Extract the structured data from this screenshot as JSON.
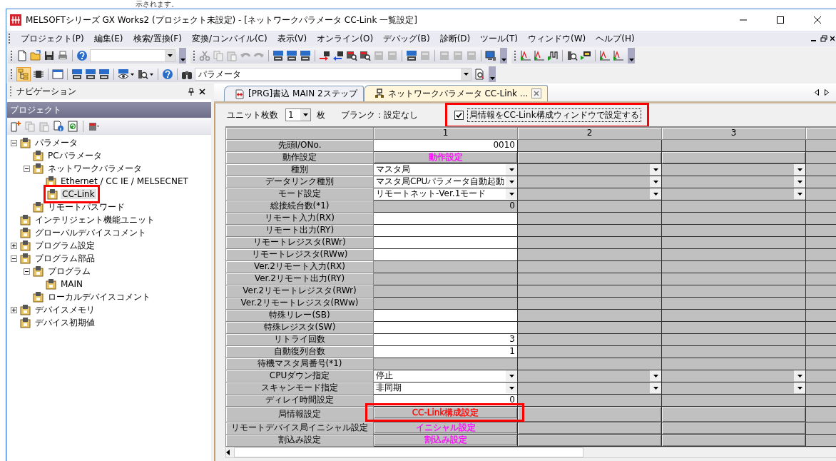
{
  "caption": "示されます。",
  "window": {
    "title": "MELSOFTシリーズ GX Works2 (プロジェクト未設定) - [ネットワークパラメータ  CC-Link 一覧設定]"
  },
  "menu": [
    "プロジェクト(P)",
    "編集(E)",
    "検索/置換(F)",
    "変換/コンパイル(C)",
    "表示(V)",
    "オンライン(O)",
    "デバッグ(B)",
    "診断(D)",
    "ツール(T)",
    "ウィンドウ(W)",
    "ヘルプ(H)"
  ],
  "toolbar": {
    "parameter_combo": {
      "value": "パラメータ"
    }
  },
  "navigation": {
    "title": "ナビゲーション",
    "section": "プロジェクト",
    "tree": [
      {
        "label": "パラメータ",
        "expanded": true,
        "selected": false,
        "highlighted": false,
        "children": [
          {
            "label": "PCパラメータ",
            "selected": false,
            "highlighted": false
          },
          {
            "label": "ネットワークパラメータ",
            "expanded": true,
            "selected": false,
            "highlighted": false,
            "children": [
              {
                "label": "Ethernet / CC IE / MELSECNET",
                "selected": false,
                "highlighted": false
              },
              {
                "label": "CC-Link",
                "selected": true,
                "highlighted": true
              }
            ]
          },
          {
            "label": "リモートパスワード",
            "selected": false,
            "highlighted": false
          }
        ]
      },
      {
        "label": "インテリジェント機能ユニット",
        "selected": false,
        "highlighted": false
      },
      {
        "label": "グローバルデバイスコメント",
        "selected": false,
        "highlighted": false
      },
      {
        "label": "プログラム設定",
        "expanded": false,
        "selected": false,
        "highlighted": false
      },
      {
        "label": "プログラム部品",
        "expanded": true,
        "selected": false,
        "highlighted": false,
        "children": [
          {
            "label": "プログラム",
            "expanded": true,
            "selected": false,
            "highlighted": false,
            "children": [
              {
                "label": "MAIN",
                "selected": false,
                "highlighted": false
              }
            ]
          },
          {
            "label": "ローカルデバイスコメント",
            "selected": false,
            "highlighted": false
          }
        ]
      },
      {
        "label": "デバイスメモリ",
        "expanded": false,
        "selected": false,
        "highlighted": false
      },
      {
        "label": "デバイス初期値",
        "selected": false,
        "highlighted": false
      }
    ]
  },
  "tabs": [
    {
      "label": "[PRG]書込 MAIN 2ステップ",
      "selected": false
    },
    {
      "label": "ネットワークパラメータ  CC-Link ...",
      "selected": true
    }
  ],
  "options": {
    "unit_count_label": "ユニット枚数",
    "unit_count": "1",
    "unit_suffix": "枚",
    "blank_note": "ブランク：設定なし",
    "station_info": {
      "label": "局情報をCC-Link構成ウィンドウで設定する",
      "checked": true,
      "highlighted": true
    }
  },
  "grid": {
    "columns": [
      "1",
      "2",
      "3"
    ],
    "rows": [
      {
        "label": "先頭I/ONo.",
        "kind": "input",
        "value": "0010",
        "highlighted": false
      },
      {
        "label": "動作設定",
        "kind": "button",
        "value": "動作設定",
        "color": "#ff00ff",
        "highlighted": false
      },
      {
        "label": "種別",
        "kind": "select",
        "value": "マスタ局",
        "highlighted": false
      },
      {
        "label": "データリンク種別",
        "kind": "select",
        "value": "マスタ局CPUパラメータ自動起動",
        "highlighted": false
      },
      {
        "label": "モード設定",
        "kind": "select",
        "value": "リモートネット-Ver.1モード",
        "highlighted": false
      },
      {
        "label": "総接続台数(*1)",
        "kind": "readonly",
        "value": "0",
        "highlighted": false
      },
      {
        "label": "リモート入力(RX)",
        "kind": "input",
        "highlighted": false
      },
      {
        "label": "リモート出力(RY)",
        "kind": "input",
        "highlighted": false
      },
      {
        "label": "リモートレジスタ(RWr)",
        "kind": "input",
        "highlighted": false
      },
      {
        "label": "リモートレジスタ(RWw)",
        "kind": "input",
        "highlighted": false
      },
      {
        "label": "Ver.2リモート入力(RX)",
        "kind": "readonly",
        "highlighted": false
      },
      {
        "label": "Ver.2リモート出力(RY)",
        "kind": "readonly",
        "highlighted": false
      },
      {
        "label": "Ver.2リモートレジスタ(RWr)",
        "kind": "readonly",
        "highlighted": false
      },
      {
        "label": "Ver.2リモートレジスタ(RWw)",
        "kind": "readonly",
        "highlighted": false
      },
      {
        "label": "特殊リレー(SB)",
        "kind": "input",
        "highlighted": false
      },
      {
        "label": "特殊レジスタ(SW)",
        "kind": "input",
        "highlighted": false
      },
      {
        "label": "リトライ回数",
        "kind": "input",
        "value": "3",
        "highlighted": false
      },
      {
        "label": "自動復列台数",
        "kind": "input",
        "value": "1",
        "highlighted": false
      },
      {
        "label": "待機マスタ局番号(*1)",
        "kind": "readonly",
        "highlighted": false
      },
      {
        "label": "CPUダウン指定",
        "kind": "select",
        "value": "停止",
        "highlighted": false
      },
      {
        "label": "スキャンモード指定",
        "kind": "select",
        "value": "非同期",
        "highlighted": false
      },
      {
        "label": "ディレイ時間設定",
        "kind": "input",
        "value": "0",
        "highlighted": false
      },
      {
        "label": "局情報設定",
        "kind": "button",
        "value": "CC-Link構成設定",
        "color": "#ff0000",
        "highlighted": true
      },
      {
        "label": "リモートデバイス局イニシャル設定",
        "kind": "button",
        "value": "イニシャル設定",
        "color": "#ff00ff",
        "highlighted": false
      },
      {
        "label": "割込み設定",
        "kind": "button",
        "value": "割込み設定",
        "color": "#ff00ff",
        "highlighted": false
      }
    ]
  }
}
